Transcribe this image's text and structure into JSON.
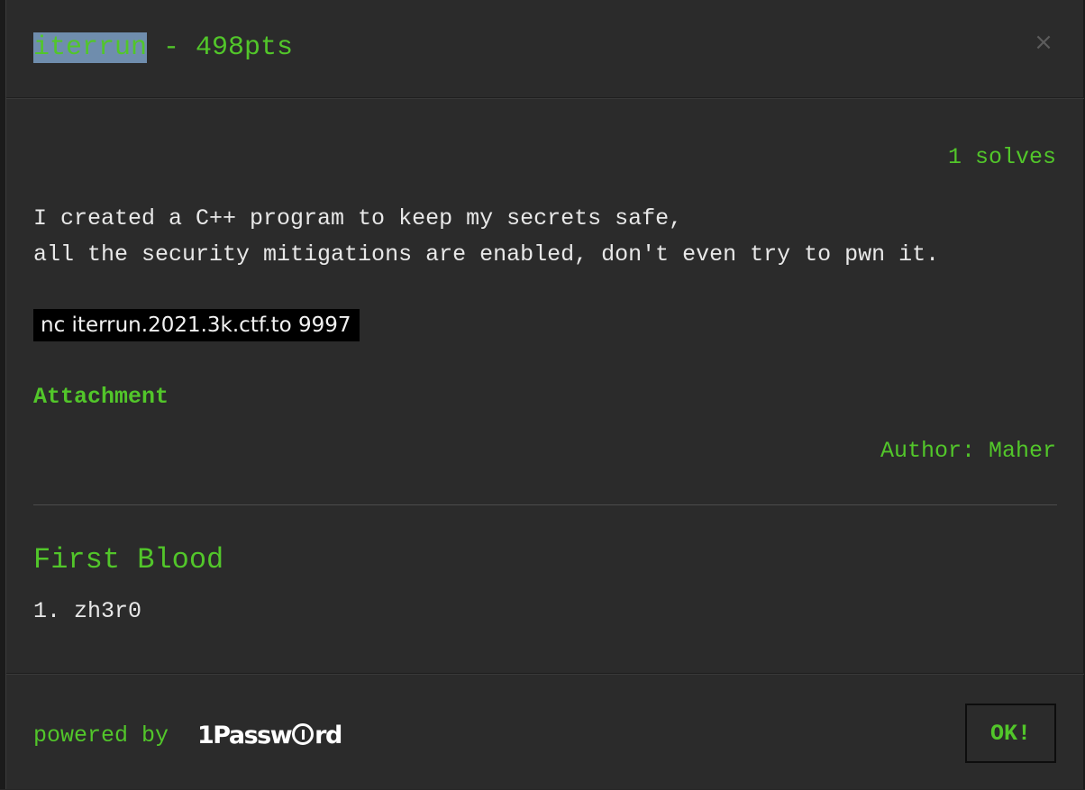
{
  "challenge": {
    "name": "iterrun",
    "points_suffix": " - 498pts",
    "solves": "1 solves",
    "description_lines": [
      "I created a C++ program to keep my secrets safe,",
      "all the security mitigations are enabled, don't even try to pwn it."
    ],
    "connection": "nc iterrun.2021.3k.ctf.to 9997",
    "attachment_label": "Attachment",
    "author": "Author: Maher"
  },
  "first_blood": {
    "title": "First Blood",
    "entries": [
      "1. zh3r0"
    ]
  },
  "footer": {
    "powered_by": "powered by",
    "sponsor_part1": "1Passw",
    "sponsor_part2": "rd",
    "ok_label": "OK!"
  },
  "icons": {
    "close": "close-icon"
  },
  "colors": {
    "accent": "#52c62a",
    "modal_bg": "#2b2b2b",
    "text": "#e8e8e8",
    "code_bg": "#000000",
    "selection": "#6f8dad"
  }
}
